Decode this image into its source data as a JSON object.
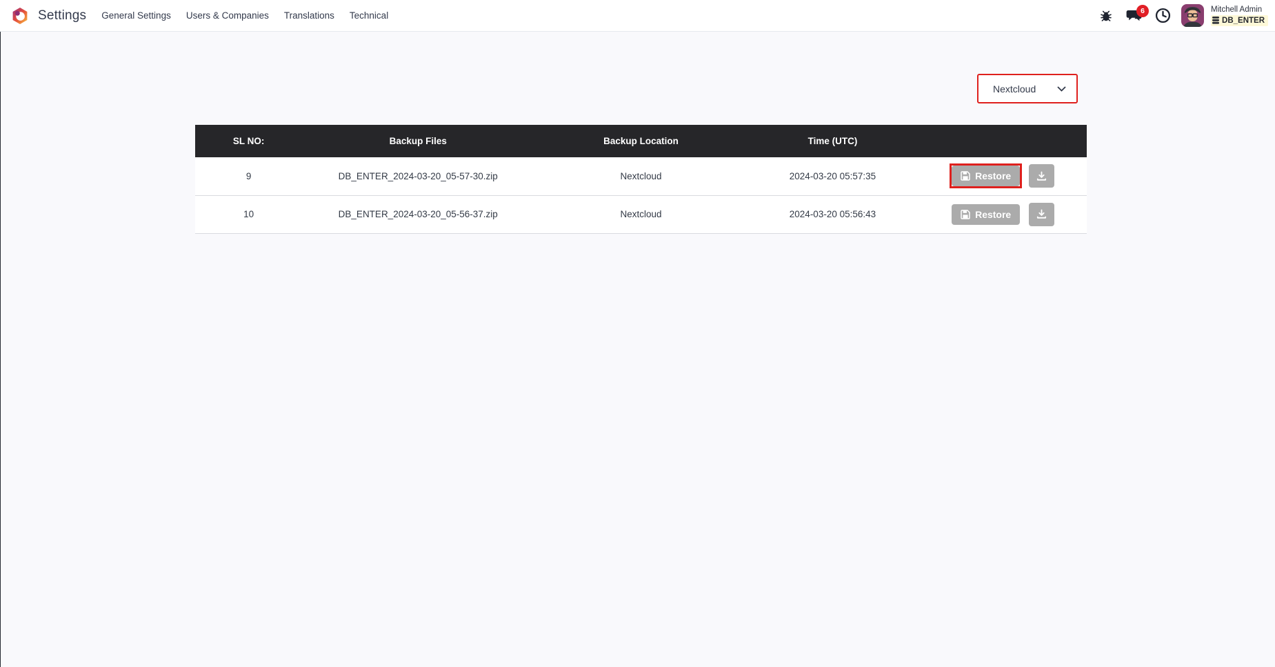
{
  "navbar": {
    "app_name": "Settings",
    "menu_items": [
      {
        "label": "General Settings"
      },
      {
        "label": "Users & Companies"
      },
      {
        "label": "Translations"
      },
      {
        "label": "Technical"
      }
    ],
    "messages_badge": "6",
    "user": {
      "name": "Mitchell Admin",
      "database": "DB_ENTER"
    }
  },
  "content": {
    "location_dropdown": {
      "value": "Nextcloud"
    },
    "table": {
      "headers": [
        "SL NO:",
        "Backup Files",
        "Backup Location",
        "Time (UTC)",
        ""
      ],
      "restore_button_label": "Restore",
      "rows": [
        {
          "sl_no": "9",
          "backup_file": "DB_ENTER_2024-03-20_05-57-30.zip",
          "location": "Nextcloud",
          "time_utc": "2024-03-20 05:57:35"
        },
        {
          "sl_no": "10",
          "backup_file": "DB_ENTER_2024-03-20_05-56-37.zip",
          "location": "Nextcloud",
          "time_utc": "2024-03-20 05:56:43"
        }
      ]
    }
  },
  "icons": {
    "odoo_logo": "odoo-hexagon-logo",
    "debug": "bug-icon",
    "messages": "chat-bubbles-icon",
    "activities": "clock-icon",
    "database": "database-icon",
    "dropdown": "chevron-down-icon",
    "restore": "save-floppy-icon",
    "download": "download-icon"
  },
  "colors": {
    "accent-red": "#df201d",
    "badge-red": "#e11f26",
    "table-header-bg": "#262629",
    "button-gray": "#ababab",
    "db-badge-bg": "#fdf8d7",
    "page-bg": "#f9f9fc",
    "nav-text": "#333a4c"
  }
}
